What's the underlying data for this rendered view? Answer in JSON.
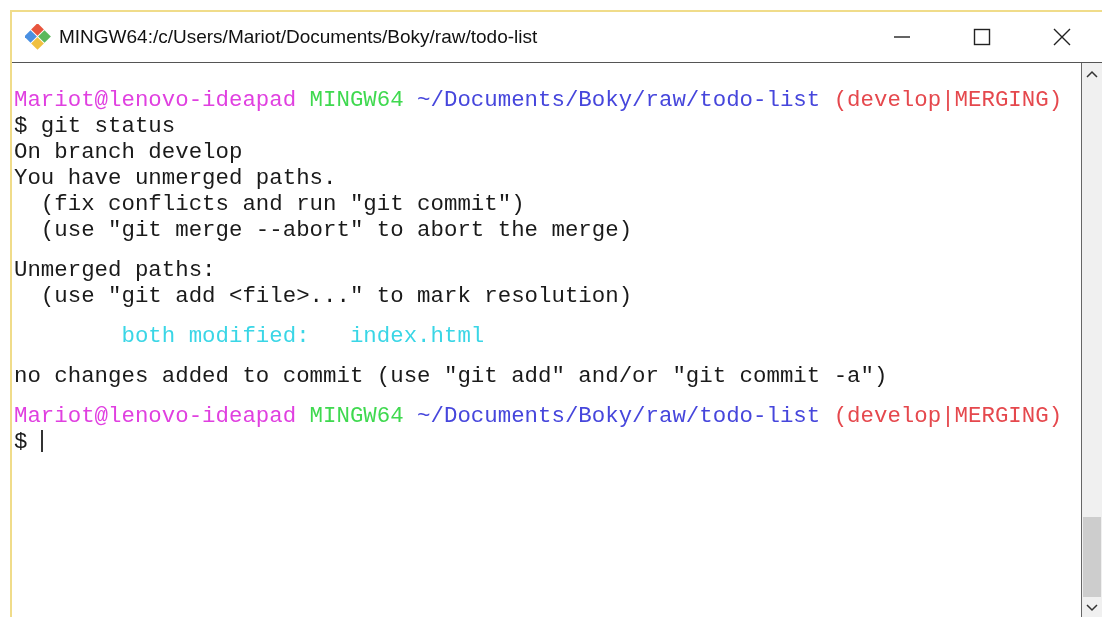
{
  "window": {
    "title": "MINGW64:/c/Users/Mariot/Documents/Boky/raw/todo-list"
  },
  "terminal": {
    "lines": [
      {
        "kind": "blank"
      },
      {
        "kind": "text",
        "segments": [
          {
            "text": "Mariot@lenovo-ideapad",
            "color": "#e040e0"
          },
          {
            "text": " MINGW64",
            "color": "#3fd94f"
          },
          {
            "text": " ~/Documents/Boky/raw/todo-list",
            "color": "#4646dc"
          },
          {
            "text": " (develop|MERGING)",
            "color": "#e5484d"
          }
        ]
      },
      {
        "kind": "text",
        "segments": [
          {
            "text": "$ git status",
            "color": "#1a1a1a"
          }
        ]
      },
      {
        "kind": "text",
        "segments": [
          {
            "text": "On branch develop",
            "color": "#1a1a1a"
          }
        ]
      },
      {
        "kind": "text",
        "segments": [
          {
            "text": "You have unmerged paths.",
            "color": "#1a1a1a"
          }
        ]
      },
      {
        "kind": "text",
        "segments": [
          {
            "text": "  (fix conflicts and run \"git commit\")",
            "color": "#1a1a1a"
          }
        ]
      },
      {
        "kind": "text",
        "segments": [
          {
            "text": "  (use \"git merge --abort\" to abort the merge)",
            "color": "#1a1a1a"
          }
        ]
      },
      {
        "kind": "blank"
      },
      {
        "kind": "text",
        "segments": [
          {
            "text": "Unmerged paths:",
            "color": "#1a1a1a"
          }
        ]
      },
      {
        "kind": "text",
        "segments": [
          {
            "text": "  (use \"git add <file>...\" to mark resolution)",
            "color": "#1a1a1a"
          }
        ]
      },
      {
        "kind": "blank"
      },
      {
        "kind": "text",
        "segments": [
          {
            "text": "        both modified:",
            "color": "#3ad6e6"
          },
          {
            "text": "   index.html",
            "color": "#3ad6e6"
          }
        ]
      },
      {
        "kind": "blank"
      },
      {
        "kind": "text",
        "segments": [
          {
            "text": "no changes added to commit (use \"git add\" and/or \"git commit -a\")",
            "color": "#1a1a1a"
          }
        ]
      },
      {
        "kind": "blank"
      },
      {
        "kind": "text",
        "segments": [
          {
            "text": "Mariot@lenovo-ideapad",
            "color": "#e040e0"
          },
          {
            "text": " MINGW64",
            "color": "#3fd94f"
          },
          {
            "text": " ~/Documents/Boky/raw/todo-list",
            "color": "#4646dc"
          },
          {
            "text": " (develop|MERGING)",
            "color": "#e5484d"
          }
        ]
      },
      {
        "kind": "prompt",
        "segments": [
          {
            "text": "$",
            "color": "#1a1a1a"
          }
        ]
      }
    ]
  }
}
